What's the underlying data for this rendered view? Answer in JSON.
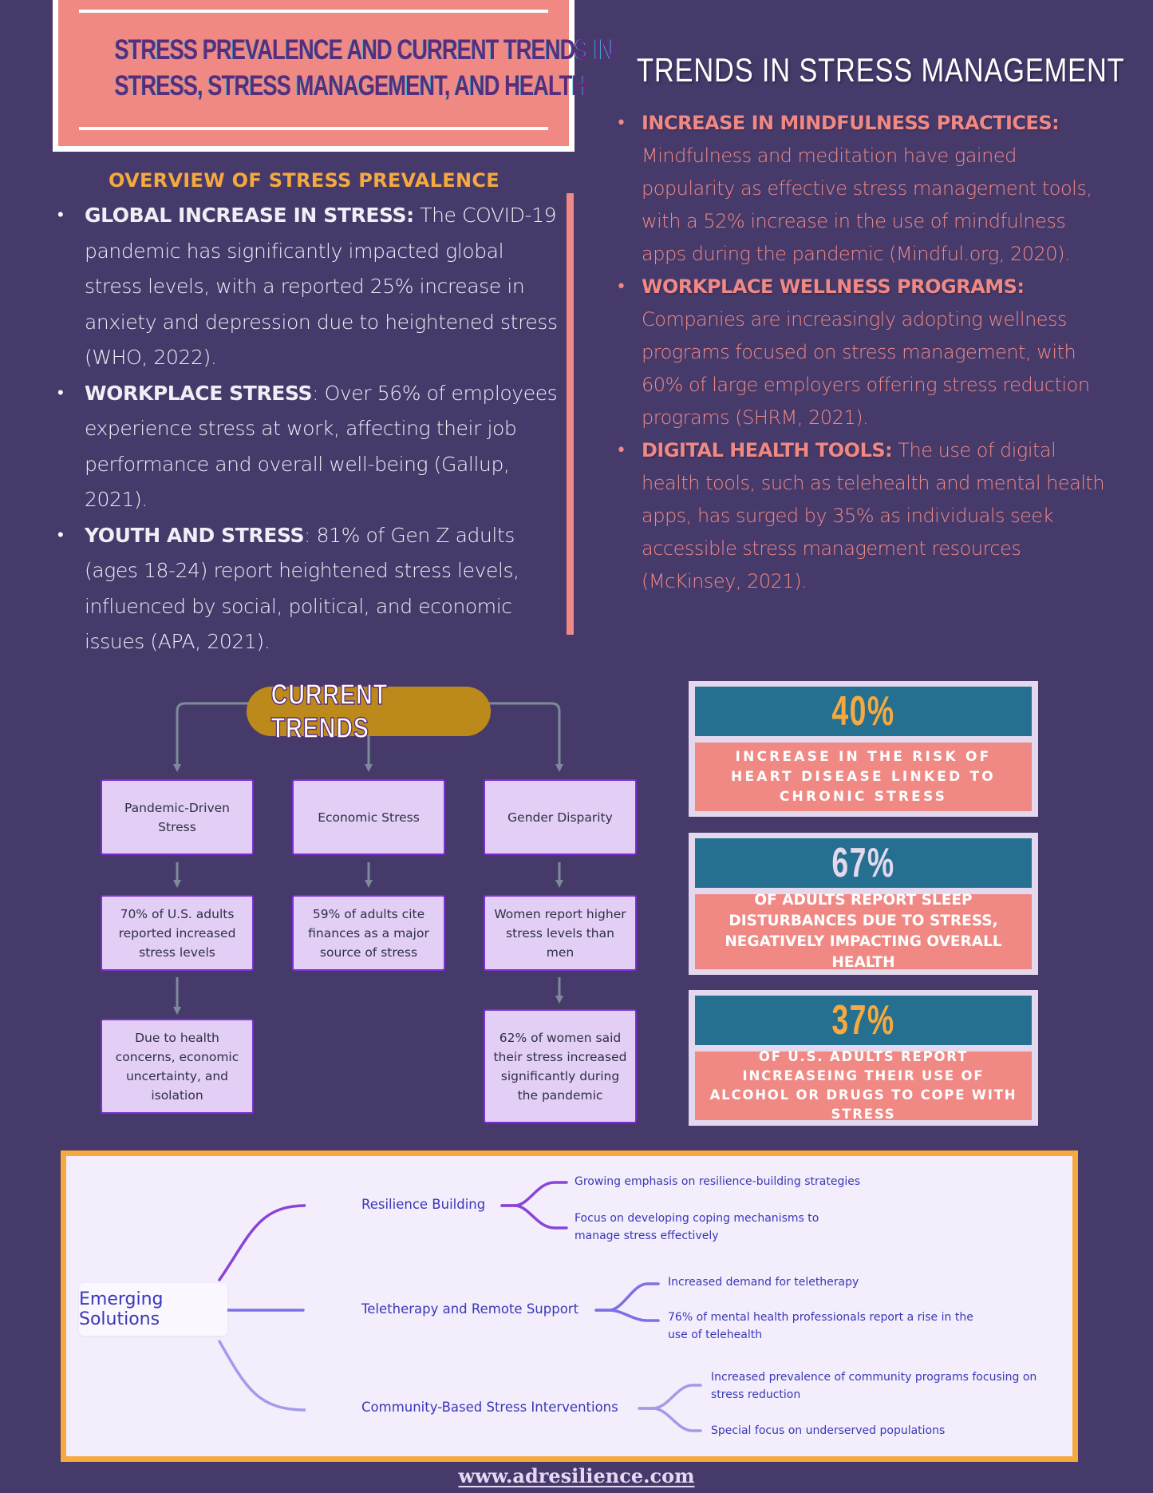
{
  "header": {
    "title_line1": "STRESS PREVALENCE AND CURRENT TRENDS IN",
    "title_line2": "STRESS, STRESS MANAGEMENT, AND HEALTH"
  },
  "overview": {
    "title": "OVERVIEW OF STRESS PREVALENCE",
    "items": [
      {
        "label": "GLOBAL INCREASE IN STRESS:",
        "text": " The COVID-19 pandemic has significantly impacted global stress levels, with a reported 25% increase in anxiety and depression due to heightened stress (WHO, 2022)."
      },
      {
        "label": "WORKPLACE STRESS",
        "text": ": Over 56% of employees experience stress at work, affecting their job performance and overall well-being (Gallup, 2021)."
      },
      {
        "label": "YOUTH AND STRESS",
        "text": ": 81% of Gen Z adults (ages 18-24) report heightened stress levels, influenced by social, political, and economic issues (APA, 2021)."
      }
    ]
  },
  "management": {
    "title": "TRENDS IN STRESS MANAGEMENT",
    "items": [
      {
        "label": "INCREASE IN MINDFULNESS PRACTICES:",
        "text": "Mindfulness and meditation have gained popularity as effective stress management tools, with a 52% increase in the use of mindfulness apps during the pandemic (Mindful.org, 2020)."
      },
      {
        "label": "WORKPLACE WELLNESS PROGRAMS:",
        "text": "Companies are increasingly adopting wellness programs focused on stress management, with 60% of large employers offering stress reduction programs (SHRM, 2021)."
      },
      {
        "label": "DIGITAL HEALTH TOOLS:",
        "text": " The use of digital health tools, such as telehealth and mental health apps, has surged by 35% as individuals seek accessible stress management resources (McKinsey, 2021)."
      }
    ]
  },
  "current_trends": {
    "title": "CURRENT TRENDS",
    "columns": [
      {
        "heading": "Pandemic-Driven Stress",
        "detail": "70% of U.S. adults reported increased stress levels",
        "sub": "Due to health concerns, economic uncertainty, and isolation"
      },
      {
        "heading": "Economic Stress",
        "detail": "59% of adults cite finances as a major source of stress",
        "sub": null
      },
      {
        "heading": "Gender Disparity",
        "detail": "Women report higher stress levels than men",
        "sub": "62% of women said their stress increased significantly during the pandemic"
      }
    ]
  },
  "stats": [
    {
      "value": "40%",
      "value_color": "#f5a93f",
      "text": "INCREASE IN THE RISK OF HEART DISEASE LINKED TO CHRONIC STRESS"
    },
    {
      "value": "67%",
      "value_color": "#e4d8ee",
      "text": "OF ADULTS REPORT SLEEP DISTURBANCES DUE TO STRESS,  NEGATIVELY IMPACTING OVERALL HEALTH"
    },
    {
      "value": "37%",
      "value_color": "#f5a93f",
      "text": "OF U.S. ADULTS REPORT INCREASEING THEIR USE OF ALCOHOL OR DRUGS TO COPE WITH STRESS"
    }
  ],
  "solutions": {
    "root": "Emerging Solutions",
    "branches": [
      {
        "label": "Resilience Building",
        "leaves": [
          "Growing emphasis on resilience-building strategies",
          "Focus on developing coping mechanisms to manage stress effectively"
        ]
      },
      {
        "label": "Teletherapy and Remote Support",
        "leaves": [
          "Increased demand for teletherapy",
          "76% of mental health professionals report a rise in the use of telehealth"
        ]
      },
      {
        "label": "Community-Based Stress Interventions",
        "leaves": [
          "Increased prevalence of community programs focusing on stress reduction",
          "Special focus on underserved populations"
        ]
      }
    ]
  },
  "colors": {
    "background": "#463a6b",
    "coral": "#f08884",
    "gold": "#f5a93f",
    "teal": "#257090",
    "lavender": "#e3cff5",
    "branch1": "#8a44d8",
    "branch2": "#7c70e6",
    "branch3": "#a59ae8"
  },
  "footer": {
    "link": "www.adresilience.com"
  }
}
